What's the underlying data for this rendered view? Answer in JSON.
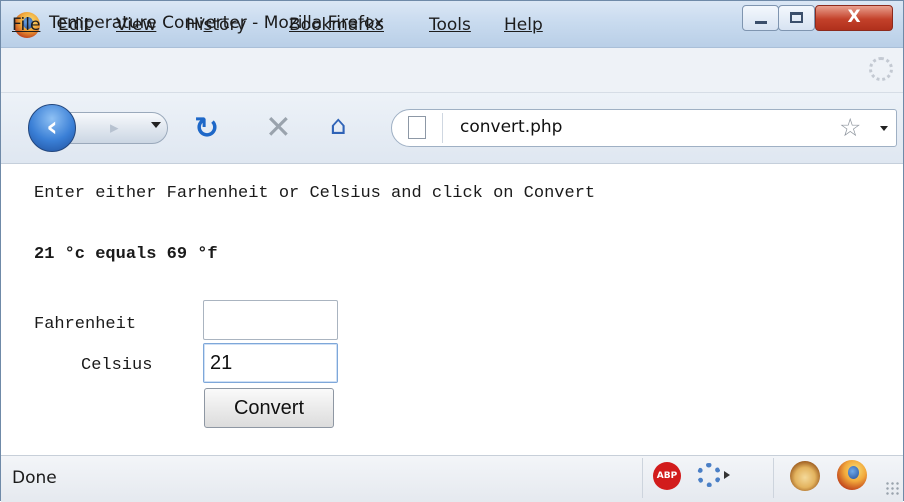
{
  "window": {
    "title": "Temperature Converter - Mozilla Firefox",
    "close_label": "X"
  },
  "menu": {
    "items": [
      {
        "label": "File",
        "accesskey_index": 0
      },
      {
        "label": "Edit",
        "accesskey_index": 0
      },
      {
        "label": "View",
        "accesskey_index": 0
      },
      {
        "label": "History",
        "accesskey_index": 2
      },
      {
        "label": "Bookmarks",
        "accesskey_index": 0
      },
      {
        "label": "Tools",
        "accesskey_index": 0
      },
      {
        "label": "Help",
        "accesskey_index": 0
      }
    ]
  },
  "toolbar": {
    "url": "convert.php",
    "icons": [
      "back-icon",
      "forward-icon",
      "history-dropdown-icon",
      "reload-icon",
      "stop-icon",
      "home-icon",
      "page-icon",
      "bookmark-star-icon"
    ]
  },
  "page": {
    "instructions": "Enter either Farhenheit or Celsius and click on Convert",
    "result": "21 °c equals 69 °f",
    "fahrenheit_label": "Fahrenheit",
    "fahrenheit_value": "",
    "celsius_label": "Celsius",
    "celsius_value": "21",
    "convert_label": "Convert"
  },
  "status": {
    "text": "Done",
    "abp_label": "ABP",
    "icons": [
      "adblock-plus-icon",
      "diagnostics-icon",
      "greasemonkey-icon",
      "firefox-icon"
    ]
  },
  "colors": {
    "titlebar": "#c9dbef",
    "close_button": "#c3412a",
    "link_blue": "#1e68c8"
  }
}
